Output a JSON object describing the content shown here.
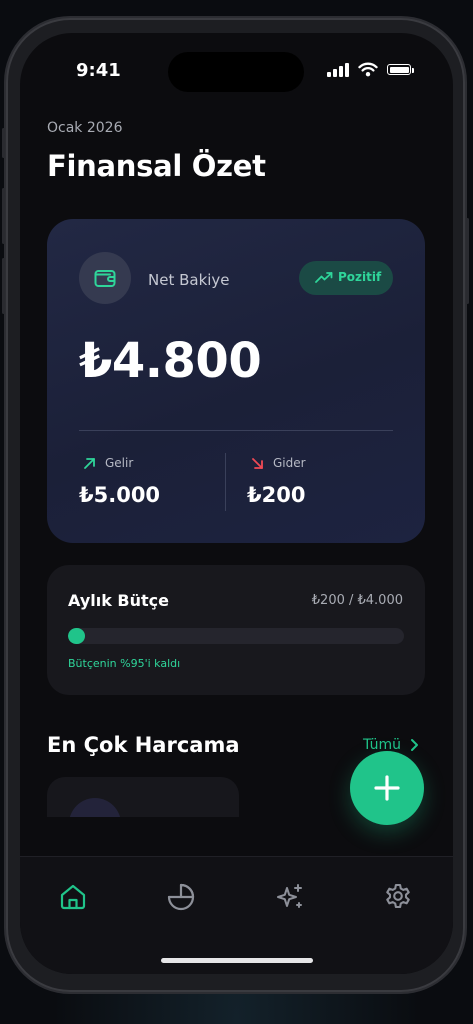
{
  "status_bar": {
    "time": "9:41",
    "icons": [
      "signal-icon",
      "wifi-icon",
      "battery-icon"
    ]
  },
  "header": {
    "month": "Ocak 2026",
    "title": "Finansal Özet"
  },
  "balance_card": {
    "icon": "wallet-icon",
    "label": "Net Bakiye",
    "badge": {
      "icon": "trending-up-icon",
      "label": "Pozitif"
    },
    "amount": "₺4.800",
    "income": {
      "icon": "arrow-up-right-icon",
      "label": "Gelir",
      "value": "₺5.000"
    },
    "expense": {
      "icon": "arrow-down-right-icon",
      "label": "Gider",
      "value": "₺200"
    }
  },
  "budget": {
    "title": "Aylık Bütçe",
    "ratio": "₺200 / ₺4.000",
    "progress_fraction": 0.05,
    "note": "Bütçenin %95'i kaldı"
  },
  "top_spending": {
    "title": "En Çok Harcama",
    "see_all": "Tümü",
    "see_all_icon": "chevron-right-icon"
  },
  "fab": {
    "icon": "plus-icon"
  },
  "tabbar": {
    "tabs": [
      {
        "icon": "home-icon",
        "active": true
      },
      {
        "icon": "pie-chart-icon",
        "active": false
      },
      {
        "icon": "sparkles-icon",
        "active": false
      },
      {
        "icon": "gear-icon",
        "active": false
      }
    ]
  },
  "colors": {
    "accent": "#20c48a",
    "accent_text": "#2fd59a",
    "income_arrow": "#2fd59a",
    "expense_arrow": "#ef4a55",
    "card_bg": "#1f2540",
    "screen_bg": "#0c0c0f",
    "inactive_icon": "#8d9099"
  }
}
